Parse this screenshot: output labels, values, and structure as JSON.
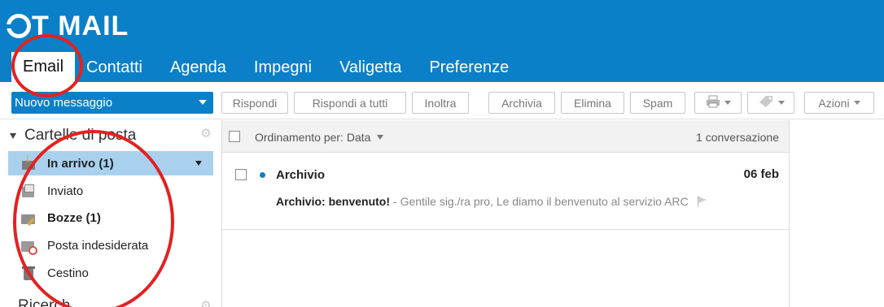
{
  "app": {
    "logo_text": "T MAIL",
    "brand_color": "#0b80c9",
    "selection_color": "#a9d1ee"
  },
  "tabs": [
    {
      "label": "Email",
      "active": true
    },
    {
      "label": "Contatti",
      "active": false
    },
    {
      "label": "Agenda",
      "active": false
    },
    {
      "label": "Impegni",
      "active": false
    },
    {
      "label": "Valigetta",
      "active": false
    },
    {
      "label": "Preferenze",
      "active": false
    }
  ],
  "toolbar": {
    "new_message": "Nuovo messaggio",
    "reply": "Rispondi",
    "reply_all": "Rispondi a tutti",
    "forward": "Inoltra",
    "archive": "Archivia",
    "delete": "Elimina",
    "spam": "Spam",
    "print_icon": "printer-icon",
    "tag_icon": "tag-icon",
    "actions": "Azioni"
  },
  "sidebar": {
    "title": "Cartelle di posta",
    "folders": [
      {
        "label": "In arrivo (1)",
        "icon": "inbox-icon",
        "bold": true,
        "selected": true
      },
      {
        "label": "Inviato",
        "icon": "sent-icon",
        "bold": false,
        "selected": false
      },
      {
        "label": "Bozze (1)",
        "icon": "drafts-icon",
        "bold": true,
        "selected": false
      },
      {
        "label": "Posta indesiderata",
        "icon": "spam-folder-icon",
        "bold": false,
        "selected": false
      },
      {
        "label": "Cestino",
        "icon": "trash-icon",
        "bold": false,
        "selected": false
      }
    ],
    "next_section": "Ricerch"
  },
  "list": {
    "sort_label": "Ordinamento per: Data",
    "count": "1 conversazione",
    "messages": [
      {
        "sender": "Archivio",
        "date": "06 feb",
        "subject": "Archivio: benvenuto!",
        "snippet": "- Gentile sig./ra pro, Le diamo il benvenuto al servizio ARC",
        "unread": true
      }
    ]
  },
  "annotation_color": "#e32121"
}
